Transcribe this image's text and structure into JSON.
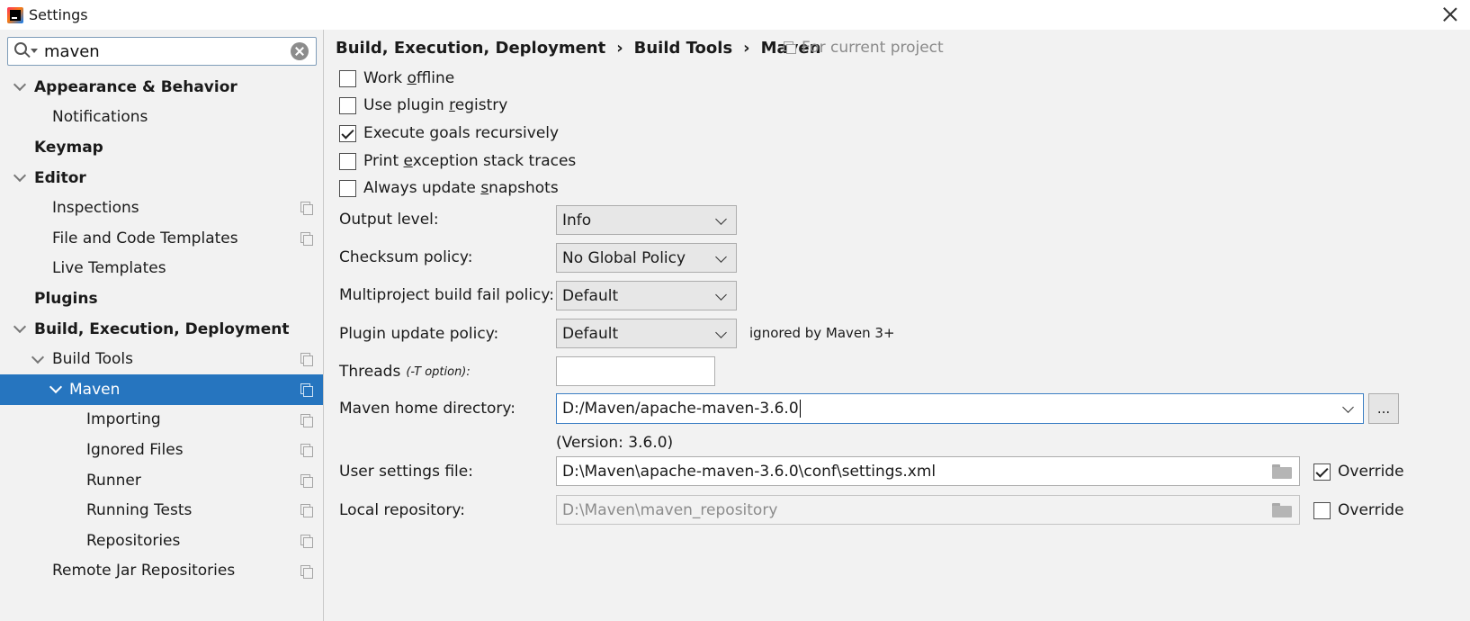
{
  "window": {
    "title": "Settings"
  },
  "search": {
    "value": "maven"
  },
  "tree": [
    {
      "label": "Appearance & Behavior",
      "level": 0,
      "bold": true,
      "expanded": true,
      "project": false,
      "selected": false
    },
    {
      "label": "Notifications",
      "level": 1,
      "bold": false,
      "project": false,
      "selected": false
    },
    {
      "label": "Keymap",
      "level": 0,
      "bold": true,
      "project": false,
      "selected": false
    },
    {
      "label": "Editor",
      "level": 0,
      "bold": true,
      "expanded": true,
      "project": false,
      "selected": false
    },
    {
      "label": "Inspections",
      "level": 1,
      "bold": false,
      "project": true,
      "selected": false
    },
    {
      "label": "File and Code Templates",
      "level": 1,
      "bold": false,
      "project": true,
      "selected": false
    },
    {
      "label": "Live Templates",
      "level": 1,
      "bold": false,
      "project": false,
      "selected": false
    },
    {
      "label": "Plugins",
      "level": 0,
      "bold": true,
      "project": false,
      "selected": false
    },
    {
      "label": "Build, Execution, Deployment",
      "level": 0,
      "bold": true,
      "expanded": true,
      "project": false,
      "selected": false
    },
    {
      "label": "Build Tools",
      "level": 1,
      "bold": false,
      "expanded": true,
      "project": true,
      "selected": false
    },
    {
      "label": "Maven",
      "level": 2,
      "bold": false,
      "expanded": true,
      "project": true,
      "selected": true
    },
    {
      "label": "Importing",
      "level": 3,
      "bold": false,
      "project": true,
      "selected": false
    },
    {
      "label": "Ignored Files",
      "level": 3,
      "bold": false,
      "project": true,
      "selected": false
    },
    {
      "label": "Runner",
      "level": 3,
      "bold": false,
      "project": true,
      "selected": false
    },
    {
      "label": "Running Tests",
      "level": 3,
      "bold": false,
      "project": true,
      "selected": false
    },
    {
      "label": "Repositories",
      "level": 3,
      "bold": false,
      "project": true,
      "selected": false
    },
    {
      "label": "Remote Jar Repositories",
      "level": 1,
      "bold": false,
      "project": true,
      "selected": false
    }
  ],
  "breadcrumb": {
    "items": [
      "Build, Execution, Deployment",
      "Build Tools",
      "Maven"
    ],
    "separator": "›",
    "scope": "For current project"
  },
  "checkboxes": [
    {
      "pre": "Work ",
      "mnemonic": "o",
      "post": "ffline",
      "checked": false
    },
    {
      "pre": "Use plugin ",
      "mnemonic": "r",
      "post": "egistry",
      "checked": false
    },
    {
      "pre": "Execute ",
      "mnemonic": "g",
      "post": "oals recursively",
      "checked": true
    },
    {
      "pre": "Print ",
      "mnemonic": "e",
      "post": "xception stack traces",
      "checked": false
    },
    {
      "pre": "Always update ",
      "mnemonic": "s",
      "post": "napshots",
      "checked": false
    }
  ],
  "form": {
    "output_level_label": "Output level:",
    "output_level_value": "Info",
    "checksum_label": "Checksum policy:",
    "checksum_value": "No Global Policy",
    "multiproject_label": "Multiproject build fail policy:",
    "multiproject_value": "Default",
    "plugin_update_label": "Plugin update policy:",
    "plugin_update_value": "Default",
    "plugin_update_note": "ignored by Maven 3+",
    "threads_label": "Threads",
    "threads_hint": "(-T option):",
    "threads_value": "",
    "home_label": "Maven home directory:",
    "home_value": "D:/Maven/apache-maven-3.6.0",
    "browse_label": "...",
    "version_text": "(Version: 3.6.0)",
    "user_settings_label": "User settings file:",
    "user_settings_value": "D:\\Maven\\apache-maven-3.6.0\\conf\\settings.xml",
    "user_settings_override": "Override",
    "user_settings_override_checked": true,
    "local_repo_label": "Local repository:",
    "local_repo_value": "D:\\Maven\\maven_repository",
    "local_repo_override": "Override",
    "local_repo_override_checked": false
  },
  "colors": {
    "selection": "#2675bf",
    "background": "#f2f2f2",
    "focus_border": "#3c7fc4"
  },
  "icons": [
    "search-icon",
    "clear-icon",
    "close-icon",
    "chevron-down-icon",
    "project-scope-icon",
    "folder-icon",
    "checkmark-icon"
  ]
}
